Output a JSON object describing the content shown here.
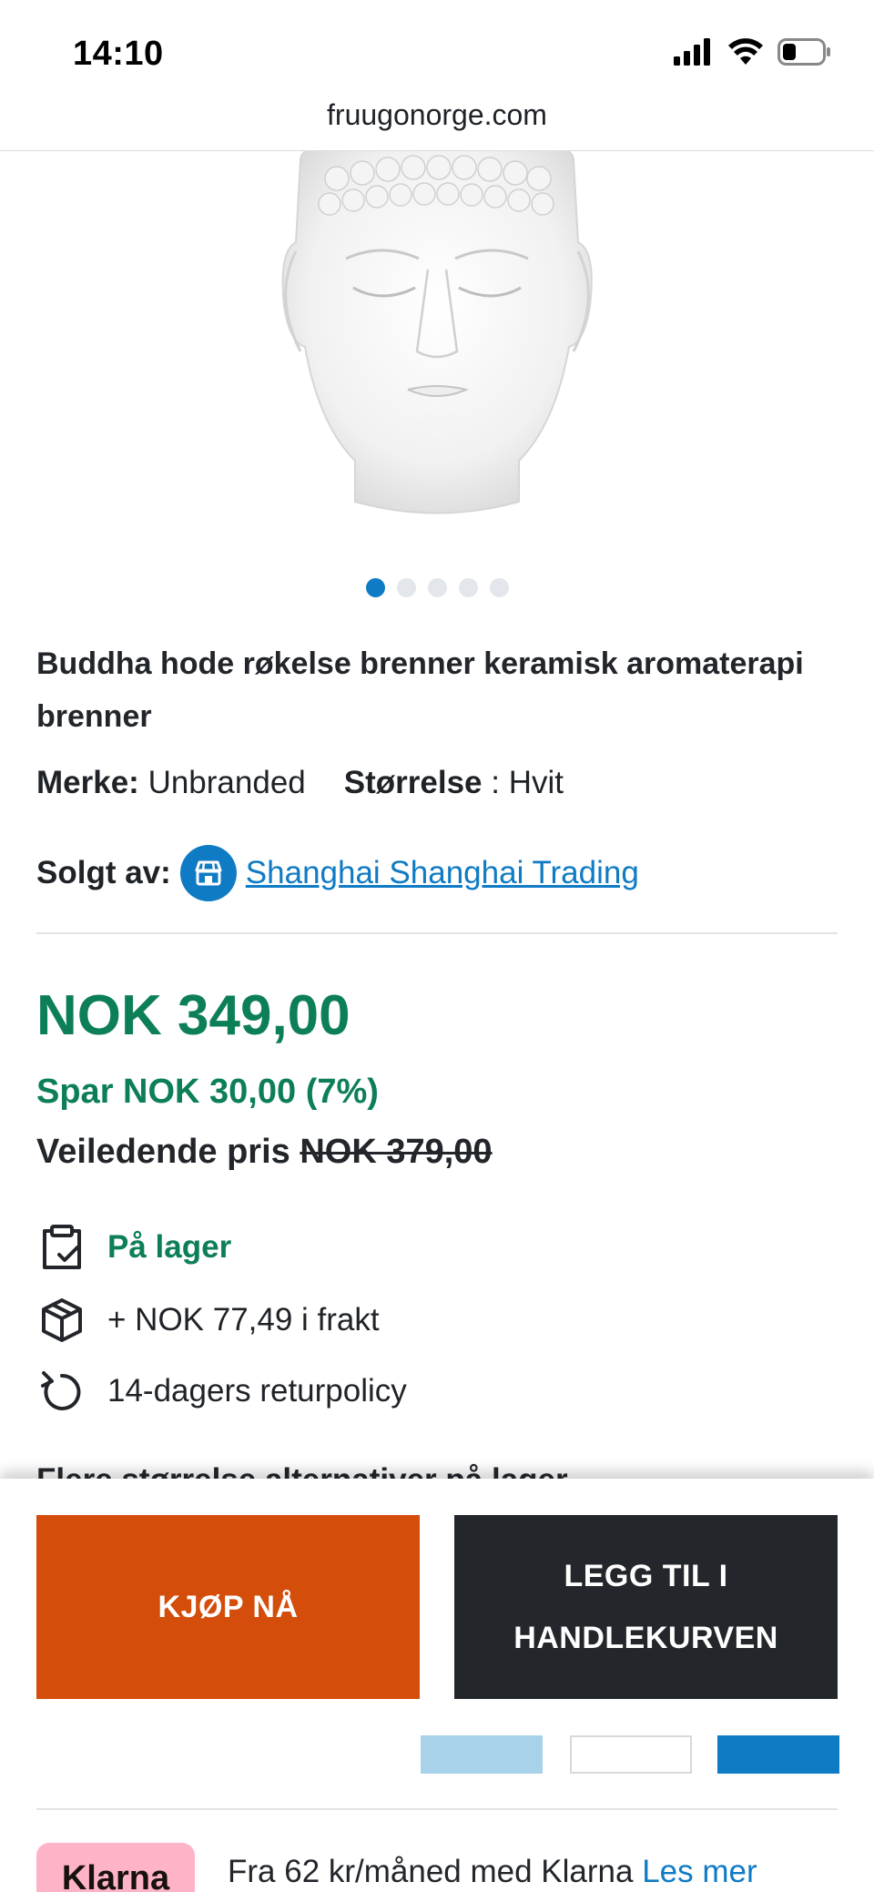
{
  "status_bar": {
    "time": "14:10"
  },
  "browser": {
    "url": "fruugonorge.com"
  },
  "gallery": {
    "image_alt": "Buddha head ceramic burner",
    "dot_count": 5,
    "active_index": 0
  },
  "product": {
    "title": "Buddha hode røkelse brenner keramisk aromaterapi brenner",
    "brand_label": "Merke:",
    "brand_value": "Unbranded",
    "size_label": "Størrelse",
    "size_value": ": Hvit",
    "seller_label": "Solgt av:",
    "seller_name": "Shanghai Shanghai Trading"
  },
  "pricing": {
    "price": "NOK 349,00",
    "save": "Spar NOK 30,00 (7%)",
    "rrp_label": "Veiledende pris",
    "rrp_value": "NOK 379,00"
  },
  "info": {
    "stock": "På lager",
    "shipping": "+ NOK 77,49 i frakt",
    "returns": "14-dagers returpolicy"
  },
  "more_sizes": "Flere størrelse alternativer på lager",
  "actions": {
    "buy_now": "KJØP NÅ",
    "add_to_cart_line1": "LEGG TIL I",
    "add_to_cart_line2": "HANDLEKURVEN"
  },
  "klarna": {
    "badge": "Klarna",
    "text": "Fra 62 kr/måned med Klarna",
    "link": "Les mer"
  },
  "colors": {
    "accent_blue": "#0f7bc4",
    "price_green": "#0d7f56",
    "buy_orange": "#d44d0a",
    "cart_dark": "#23262b",
    "klarna_pink": "#ffb3c7"
  }
}
